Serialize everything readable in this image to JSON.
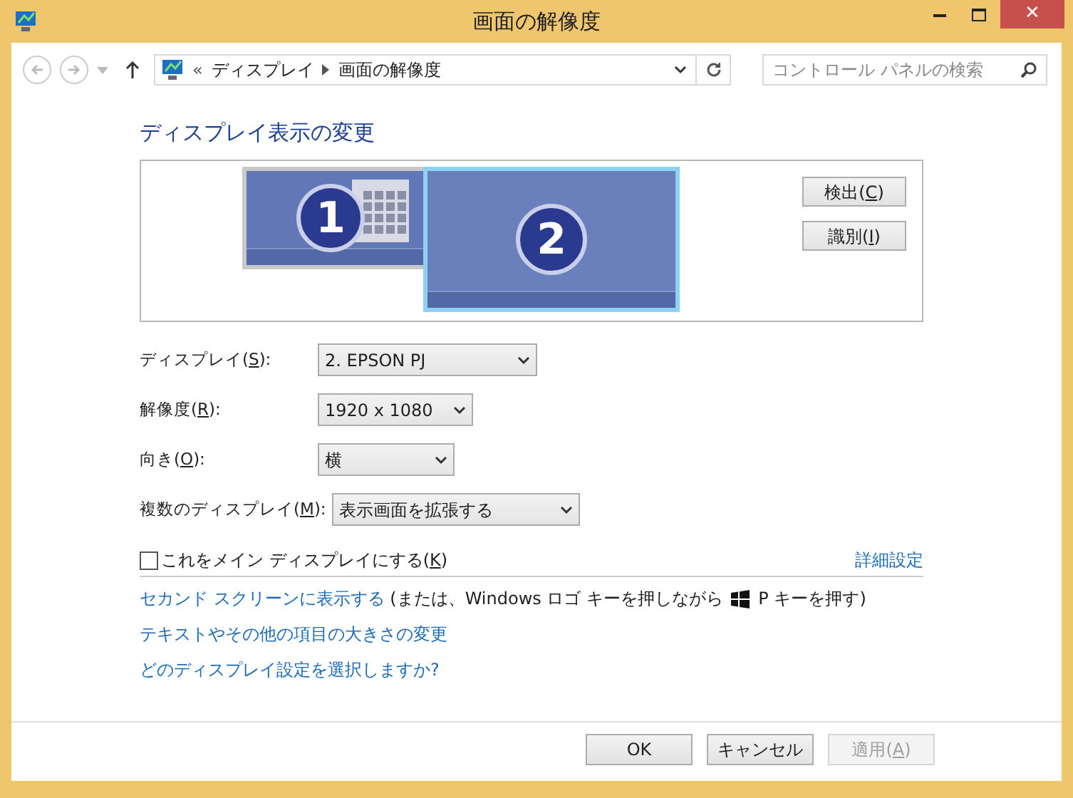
{
  "window": {
    "title": "画面の解像度",
    "close": "✕"
  },
  "address": {
    "overflow": "«",
    "crumbs": [
      "ディスプレイ",
      "画面の解像度"
    ],
    "search_placeholder": "コントロール パネルの検索"
  },
  "heading": "ディスプレイ表示の変更",
  "monitors": [
    {
      "number": "1",
      "selected": false
    },
    {
      "number": "2",
      "selected": true
    }
  ],
  "preview_buttons": [
    {
      "before": "検出(",
      "key": "C",
      "after": ")"
    },
    {
      "before": "識別(",
      "key": "I",
      "after": ")"
    }
  ],
  "settings": [
    {
      "before": "ディスプレイ(",
      "key": "S",
      "after": "):",
      "value": "2. EPSON PJ"
    },
    {
      "before": "解像度(",
      "key": "R",
      "after": "):",
      "value": "1920 x 1080"
    },
    {
      "before": "向き(",
      "key": "O",
      "after": "):",
      "value": "横"
    },
    {
      "before": "複数のディスプレイ(",
      "key": "M",
      "after": "):",
      "value": "表示画面を拡張する"
    }
  ],
  "main_display": {
    "before": "これをメイン ディスプレイにする(",
    "key": "K",
    "after": ")",
    "checked": false
  },
  "advanced_link": "詳細設定",
  "second_screen": {
    "link": "セカンド スクリーンに表示する",
    "text_before": " (または、Windows ロゴ キーを押しながら ",
    "text_after": " P キーを押す)"
  },
  "links": [
    "テキストやその他の項目の大きさの変更",
    "どのディスプレイ設定を選択しますか?"
  ],
  "buttons": [
    {
      "before": "OK",
      "disabled": false
    },
    {
      "before": "キャンセル",
      "disabled": false
    },
    {
      "before": "適用(",
      "key": "A",
      "after": ")",
      "disabled": true
    }
  ]
}
